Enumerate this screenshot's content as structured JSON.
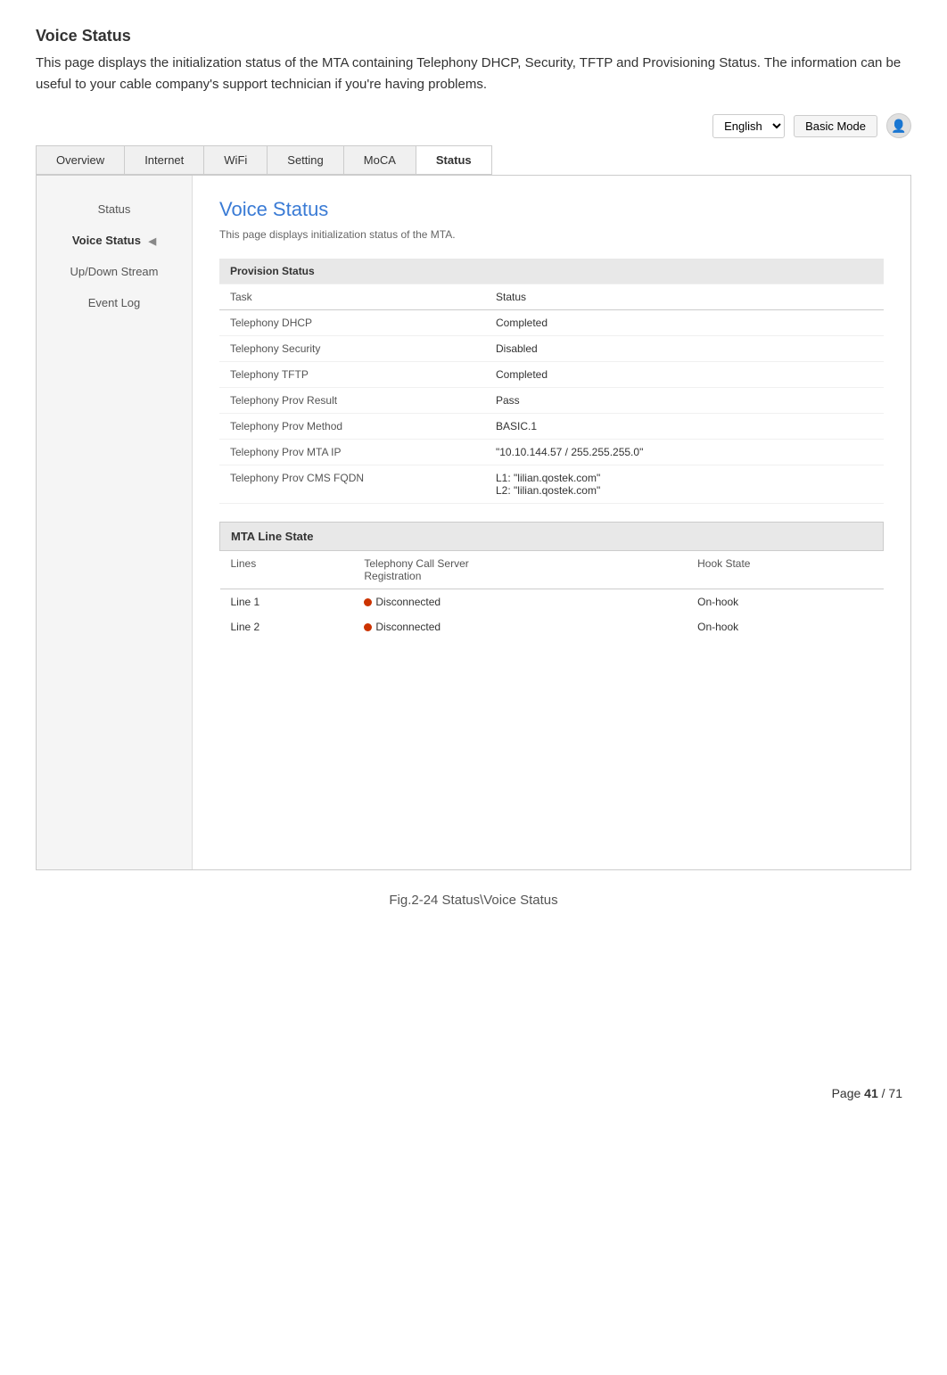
{
  "page": {
    "title": "Voice Status",
    "description": "This page displays the initialization status of the MTA containing Telephony DHCP, Security, TFTP and Provisioning Status. The information can be useful to your cable company's support   technician if you're having problems."
  },
  "topbar": {
    "language_label": "English",
    "basic_mode_label": "Basic Mode",
    "user_icon": "👤"
  },
  "nav": {
    "tabs": [
      {
        "label": "Overview",
        "active": false
      },
      {
        "label": "Internet",
        "active": false
      },
      {
        "label": "WiFi",
        "active": false
      },
      {
        "label": "Setting",
        "active": false
      },
      {
        "label": "MoCA",
        "active": false
      },
      {
        "label": "Status",
        "active": true
      }
    ]
  },
  "sidebar": {
    "items": [
      {
        "label": "Status",
        "active": false
      },
      {
        "label": "Voice Status",
        "active": true
      },
      {
        "label": "Up/Down Stream",
        "active": false
      },
      {
        "label": "Event Log",
        "active": false
      }
    ]
  },
  "content": {
    "title": "Voice Status",
    "subtitle": "This page displays initialization status of the MTA.",
    "provision_section": {
      "header": "Provision Status",
      "col_task": "Task",
      "col_status": "Status",
      "rows": [
        {
          "task": "Telephony DHCP",
          "status": "Completed"
        },
        {
          "task": "Telephony Security",
          "status": "Disabled"
        },
        {
          "task": "Telephony TFTP",
          "status": "Completed"
        },
        {
          "task": "Telephony Prov Result",
          "status": "Pass"
        },
        {
          "task": "Telephony Prov Method",
          "status": "BASIC.1"
        },
        {
          "task": "Telephony Prov MTA IP",
          "status": "\"10.10.144.57 / 255.255.255.0\""
        },
        {
          "task": "Telephony Prov CMS FQDN",
          "status_line1": "L1: \"lilian.qostek.com\"",
          "status_line2": "L2: \"lilian.qostek.com\""
        }
      ]
    },
    "mta_section": {
      "header": "MTA Line State",
      "col_lines": "Lines",
      "col_registration": "Telephony Call Server Registration",
      "col_hook": "Hook State",
      "rows": [
        {
          "line": "Line 1",
          "registration": "Disconnected",
          "hook": "On-hook"
        },
        {
          "line": "Line 2",
          "registration": "Disconnected",
          "hook": "On-hook"
        }
      ]
    }
  },
  "figure_caption": "Fig.2-24 Status\\Voice Status",
  "page_number": {
    "text": "Page ",
    "current": "41",
    "separator": " / ",
    "total": "71"
  }
}
